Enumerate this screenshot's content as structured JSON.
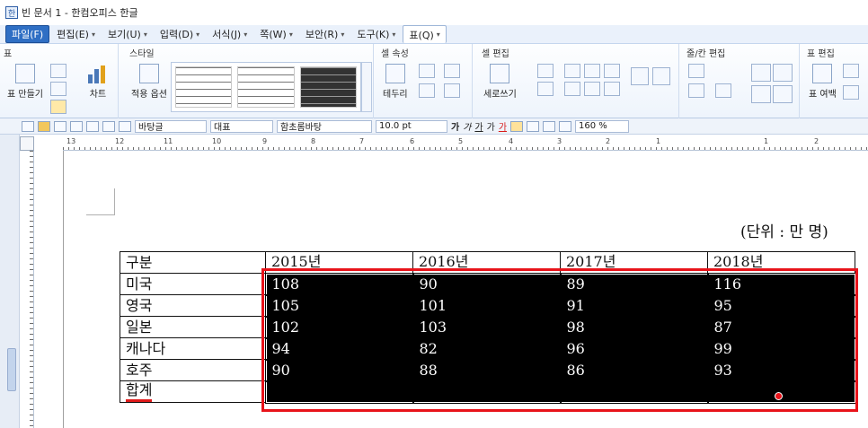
{
  "window": {
    "title": "빈 문서 1 - 한컴오피스 한글"
  },
  "menubar": [
    {
      "label": "파일(F)"
    },
    {
      "label": "편집(E)"
    },
    {
      "label": "보기(U)"
    },
    {
      "label": "입력(D)"
    },
    {
      "label": "서식(J)"
    },
    {
      "label": "쪽(W)"
    },
    {
      "label": "보안(R)"
    },
    {
      "label": "도구(K)"
    },
    {
      "label": "표(Q)"
    }
  ],
  "ribbon": {
    "groups": {
      "table": "표",
      "style": "스타일",
      "cell_props": "셀 속성",
      "cell_edit": "셀 편집",
      "rowcol_edit": "줄/칸 편집",
      "table_edit": "표 편집"
    },
    "buttons": {
      "make_table": "표 만들기",
      "chart": "차트",
      "apply_options": "적용 옵션",
      "border": "테두리",
      "vertical_write": "세로쓰기",
      "table_margin": "표 여백"
    }
  },
  "format_toolbar": {
    "style": "바탕글",
    "language": "대표",
    "font": "함초롬바탕",
    "size": "10.0",
    "size_unit": "pt",
    "bold": "가",
    "italic": "가",
    "underline": "가",
    "strike": "가",
    "color_text": "가",
    "line_spacing": "160",
    "line_spacing_unit": "%"
  },
  "ruler": {
    "labels": [
      "13",
      "12",
      "11",
      "10",
      "9",
      "8",
      "7",
      "6",
      "5",
      "4",
      "3",
      "2",
      "1",
      "1",
      "2"
    ]
  },
  "document": {
    "unit_label": "(단위 : 만 명)",
    "table": {
      "header_label": "구분",
      "years": [
        "2015년",
        "2016년",
        "2017년",
        "2018년"
      ],
      "rows": [
        {
          "label": "미국",
          "values": [
            "108",
            "90",
            "89",
            "116"
          ]
        },
        {
          "label": "영국",
          "values": [
            "105",
            "101",
            "91",
            "95"
          ]
        },
        {
          "label": "일본",
          "values": [
            "102",
            "103",
            "98",
            "87"
          ]
        },
        {
          "label": "캐나다",
          "values": [
            "94",
            "82",
            "96",
            "99"
          ]
        },
        {
          "label": "호주",
          "values": [
            "90",
            "88",
            "86",
            "93"
          ]
        },
        {
          "label": "합계",
          "values": [
            "",
            "",
            "",
            ""
          ]
        }
      ]
    }
  },
  "colors": {
    "selection": "#e8131a",
    "selected_cell_bg": "#000000",
    "ribbon_accent": "#2f6fc4"
  }
}
